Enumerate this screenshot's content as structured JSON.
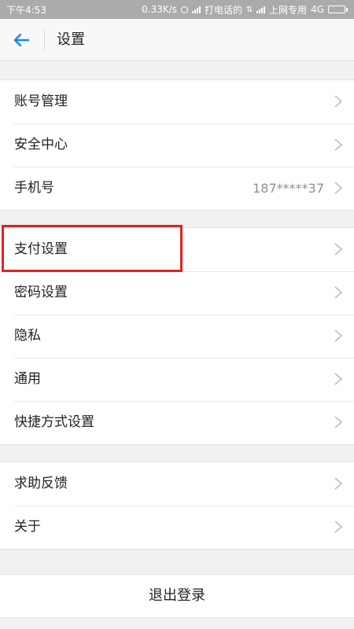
{
  "status_bar": {
    "time": "下午4:53",
    "net_speed": "0.33K/s",
    "sim1_label": "打电话的",
    "sim2_label": "上网专用",
    "network": "4G",
    "battery_level": 0.9
  },
  "header": {
    "title": "设置",
    "back_icon": "back-arrow-icon",
    "accent_color": "#1a87e6"
  },
  "groups": [
    {
      "items": [
        {
          "label": "账号管理",
          "value": ""
        },
        {
          "label": "安全中心",
          "value": ""
        },
        {
          "label": "手机号",
          "value": "187*****37"
        }
      ]
    },
    {
      "items": [
        {
          "label": "支付设置",
          "value": ""
        },
        {
          "label": "密码设置",
          "value": ""
        },
        {
          "label": "隐私",
          "value": ""
        },
        {
          "label": "通用",
          "value": ""
        },
        {
          "label": "快捷方式设置",
          "value": ""
        }
      ]
    },
    {
      "items": [
        {
          "label": "求助反馈",
          "value": ""
        },
        {
          "label": "关于",
          "value": ""
        }
      ]
    }
  ],
  "logout_label": "退出登录",
  "highlight": {
    "item": "支付设置",
    "color": "#e81f1f"
  }
}
